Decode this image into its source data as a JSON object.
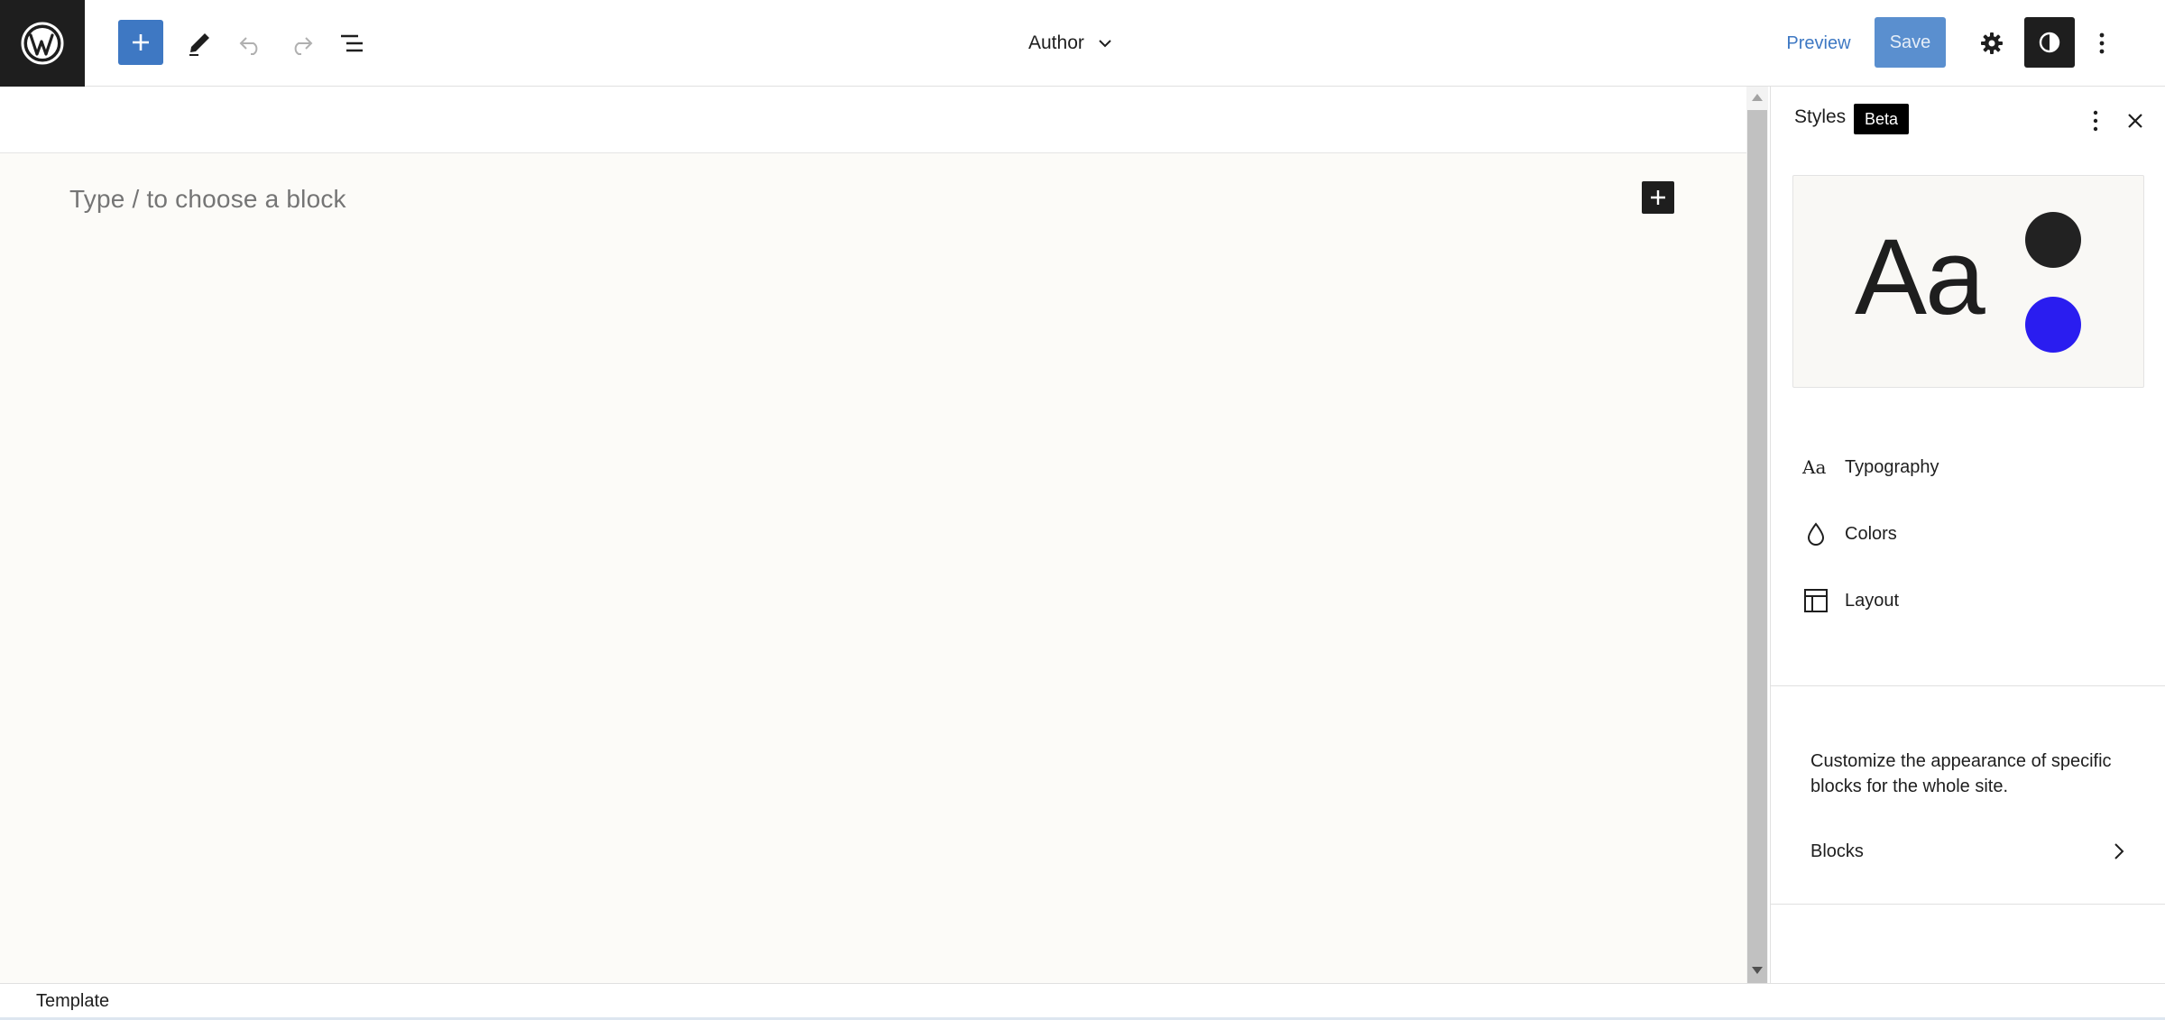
{
  "topbar": {
    "document_title": "Author",
    "preview_label": "Preview",
    "save_label": "Save"
  },
  "canvas": {
    "placeholder": "Type / to choose a block"
  },
  "sidebar": {
    "title": "Styles",
    "badge": "Beta",
    "preview_text": "Aa",
    "preview_colors": [
      "#222222",
      "#2a1df0"
    ],
    "items": [
      {
        "label": "Typography",
        "icon": "typography-icon"
      },
      {
        "label": "Colors",
        "icon": "droplet-icon"
      },
      {
        "label": "Layout",
        "icon": "layout-icon"
      }
    ],
    "blocks_description": "Customize the appearance of specific blocks for the whole site.",
    "blocks_label": "Blocks"
  },
  "footer": {
    "breadcrumb": "Template"
  },
  "colors": {
    "accent": "#3e78c3",
    "dark": "#1e1e1e"
  }
}
